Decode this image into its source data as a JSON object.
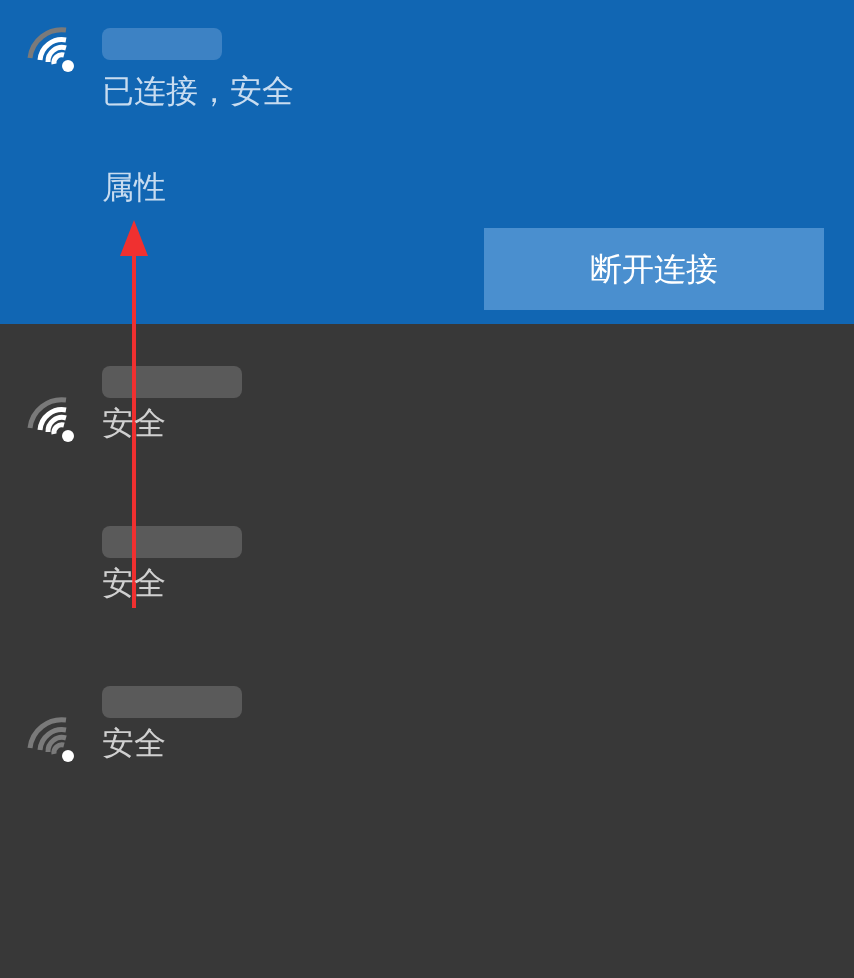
{
  "connected": {
    "status": "已连接，安全",
    "properties_link": "属性",
    "disconnect_button": "断开连接",
    "kind": "strong"
  },
  "networks": [
    {
      "security": "安全",
      "kind": "strong"
    },
    {
      "security": "安全",
      "kind": "hidden"
    },
    {
      "security": "安全",
      "kind": "weak"
    }
  ]
}
